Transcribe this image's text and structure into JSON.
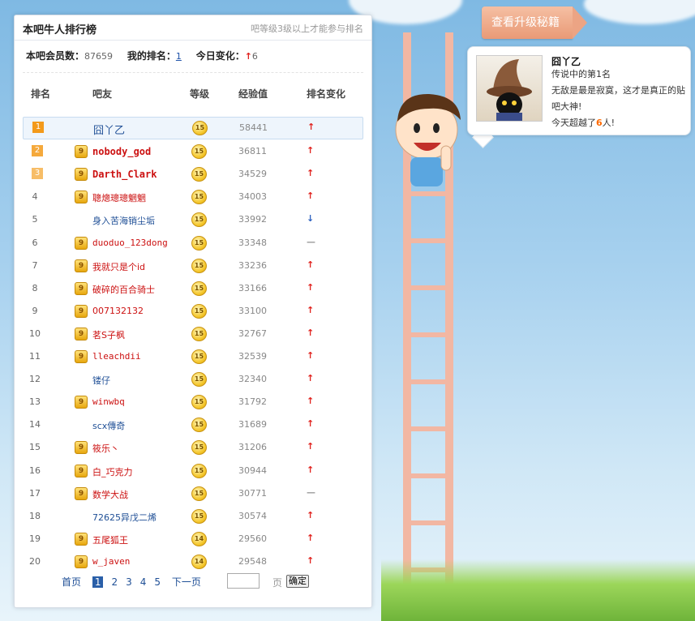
{
  "panel": {
    "title": "本吧牛人排行榜",
    "note": "吧等级3级以上才能参与排名"
  },
  "stats": {
    "members_label": "本吧会员数：",
    "members": "87659",
    "myrank_label": "我的排名：",
    "myrank": "1",
    "change_label": "今日变化：",
    "change": "6"
  },
  "table": {
    "headers": [
      "排名",
      "吧友",
      "等级",
      "经验值",
      "排名变化"
    ],
    "rows": [
      {
        "rank": "1",
        "name": "囧丫乙",
        "level": "15",
        "exp": "58441",
        "change": "up",
        "vip": false,
        "style": "me"
      },
      {
        "rank": "2",
        "name": "nobody_god",
        "level": "15",
        "exp": "36811",
        "change": "up",
        "vip": true,
        "style": "bold"
      },
      {
        "rank": "3",
        "name": "Darth_Clark",
        "level": "15",
        "exp": "34529",
        "change": "up",
        "vip": true,
        "style": "bold"
      },
      {
        "rank": "4",
        "name": "聰熜璁璁魍魍",
        "level": "15",
        "exp": "34003",
        "change": "up",
        "vip": true,
        "style": "red"
      },
      {
        "rank": "5",
        "name": "身入苦海销尘垢",
        "level": "15",
        "exp": "33992",
        "change": "down",
        "vip": false,
        "style": "blue"
      },
      {
        "rank": "6",
        "name": "duoduo_123dong",
        "level": "15",
        "exp": "33348",
        "change": "flat",
        "vip": true,
        "style": "red-mono"
      },
      {
        "rank": "7",
        "name": "我就只是个id",
        "level": "15",
        "exp": "33236",
        "change": "up",
        "vip": true,
        "style": "red"
      },
      {
        "rank": "8",
        "name": "破碎的百合骑士",
        "level": "15",
        "exp": "33166",
        "change": "up",
        "vip": true,
        "style": "red"
      },
      {
        "rank": "9",
        "name": "007132132",
        "level": "15",
        "exp": "33100",
        "change": "up",
        "vip": true,
        "style": "red"
      },
      {
        "rank": "10",
        "name": "茗S子枫",
        "level": "15",
        "exp": "32767",
        "change": "up",
        "vip": true,
        "style": "red"
      },
      {
        "rank": "11",
        "name": "lleachdii",
        "level": "15",
        "exp": "32539",
        "change": "up",
        "vip": true,
        "style": "red-mono"
      },
      {
        "rank": "12",
        "name": "镂仔",
        "level": "15",
        "exp": "32340",
        "change": "up",
        "vip": false,
        "style": "blue"
      },
      {
        "rank": "13",
        "name": "winwbq",
        "level": "15",
        "exp": "31792",
        "change": "up",
        "vip": true,
        "style": "red-mono"
      },
      {
        "rank": "14",
        "name": "scx傳奇",
        "level": "15",
        "exp": "31689",
        "change": "up",
        "vip": false,
        "style": "blue"
      },
      {
        "rank": "15",
        "name": "筱乐丶",
        "level": "15",
        "exp": "31206",
        "change": "up",
        "vip": true,
        "style": "red"
      },
      {
        "rank": "16",
        "name": "白_巧克力",
        "level": "15",
        "exp": "30944",
        "change": "up",
        "vip": true,
        "style": "red"
      },
      {
        "rank": "17",
        "name": "数学大战",
        "level": "15",
        "exp": "30771",
        "change": "flat",
        "vip": true,
        "style": "red"
      },
      {
        "rank": "18",
        "name": "72625异戊二烯",
        "level": "15",
        "exp": "30574",
        "change": "up",
        "vip": false,
        "style": "blue"
      },
      {
        "rank": "19",
        "name": "五尾狐王",
        "level": "14",
        "exp": "29560",
        "change": "up",
        "vip": true,
        "style": "red"
      },
      {
        "rank": "20",
        "name": "w_javen",
        "level": "14",
        "exp": "29548",
        "change": "up",
        "vip": true,
        "style": "red-mono"
      }
    ]
  },
  "pager": {
    "first": "首页",
    "pages": [
      "1",
      "2",
      "3",
      "4",
      "5"
    ],
    "current": "1",
    "next": "下一页",
    "page_label": "页",
    "ok": "确定"
  },
  "upgrade": {
    "label": "查看升级秘籍"
  },
  "card": {
    "name": "囧丫乙",
    "line1": "传说中的第1名",
    "line2": "无敌是最是寂寞，这才是真正的贴吧大神!",
    "line3_pre": "今天超越了",
    "line3_num": "6",
    "line3_post": "人!"
  },
  "colors": {
    "accent": "#2a5fa8",
    "up": "#e0201c",
    "down": "#2a5fbf",
    "vip": "#e7a70e"
  }
}
